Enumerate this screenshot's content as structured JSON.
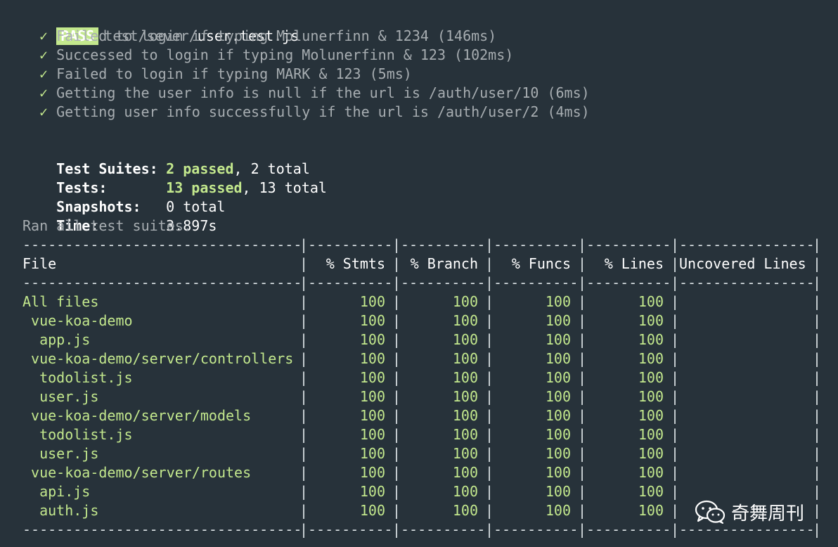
{
  "header": {
    "status": "PASS",
    "path_prefix": "test/sever/",
    "filename": "user.test.js"
  },
  "tests": [
    {
      "check": "✓",
      "text": "Failed to login if typing Molunerfinn & 1234 (146ms)"
    },
    {
      "check": "✓",
      "text": "Successed to login if typing Molunerfinn & 123 (102ms)"
    },
    {
      "check": "✓",
      "text": "Failed to login if typing MARK & 123 (5ms)"
    },
    {
      "check": "✓",
      "text": "Getting the user info is null if the url is /auth/user/10 (6ms)"
    },
    {
      "check": "✓",
      "text": "Getting user info successfully if the url is /auth/user/2 (4ms)"
    }
  ],
  "summary": {
    "suites_label": "Test Suites:",
    "suites_passed": "2 passed",
    "suites_total": ", 2 total",
    "tests_label": "Tests:",
    "tests_passed": "13 passed",
    "tests_total": ", 13 total",
    "snapshots_label": "Snapshots:",
    "snapshots_value": "0 total",
    "time_label": "Time:",
    "time_value": "3.897s",
    "ran_all": "Ran all test suites."
  },
  "coverage": {
    "headers": {
      "file": "File",
      "stmts": "% Stmts",
      "branch": "% Branch",
      "funcs": "% Funcs",
      "lines": "% Lines",
      "uncovered": "Uncovered Lines"
    },
    "rows": [
      {
        "file": "All files",
        "stmts": "100",
        "branch": "100",
        "funcs": "100",
        "lines": "100",
        "uncovered": ""
      },
      {
        "file": " vue-koa-demo",
        "stmts": "100",
        "branch": "100",
        "funcs": "100",
        "lines": "100",
        "uncovered": ""
      },
      {
        "file": "  app.js",
        "stmts": "100",
        "branch": "100",
        "funcs": "100",
        "lines": "100",
        "uncovered": ""
      },
      {
        "file": " vue-koa-demo/server/controllers",
        "stmts": "100",
        "branch": "100",
        "funcs": "100",
        "lines": "100",
        "uncovered": ""
      },
      {
        "file": "  todolist.js",
        "stmts": "100",
        "branch": "100",
        "funcs": "100",
        "lines": "100",
        "uncovered": ""
      },
      {
        "file": "  user.js",
        "stmts": "100",
        "branch": "100",
        "funcs": "100",
        "lines": "100",
        "uncovered": ""
      },
      {
        "file": " vue-koa-demo/server/models",
        "stmts": "100",
        "branch": "100",
        "funcs": "100",
        "lines": "100",
        "uncovered": ""
      },
      {
        "file": "  todolist.js",
        "stmts": "100",
        "branch": "100",
        "funcs": "100",
        "lines": "100",
        "uncovered": ""
      },
      {
        "file": "  user.js",
        "stmts": "100",
        "branch": "100",
        "funcs": "100",
        "lines": "100",
        "uncovered": ""
      },
      {
        "file": " vue-koa-demo/server/routes",
        "stmts": "100",
        "branch": "100",
        "funcs": "100",
        "lines": "100",
        "uncovered": ""
      },
      {
        "file": "  api.js",
        "stmts": "100",
        "branch": "100",
        "funcs": "100",
        "lines": "100",
        "uncovered": ""
      },
      {
        "file": "  auth.js",
        "stmts": "100",
        "branch": "100",
        "funcs": "100",
        "lines": "100",
        "uncovered": ""
      }
    ]
  },
  "watermark": {
    "icon": "wechat-icon",
    "text": "奇舞周刊"
  },
  "colors": {
    "background": "#27323a",
    "pass_badge": "#c3e88d",
    "covered_green": "#c3e88d",
    "dim_text": "#a7adb1"
  }
}
